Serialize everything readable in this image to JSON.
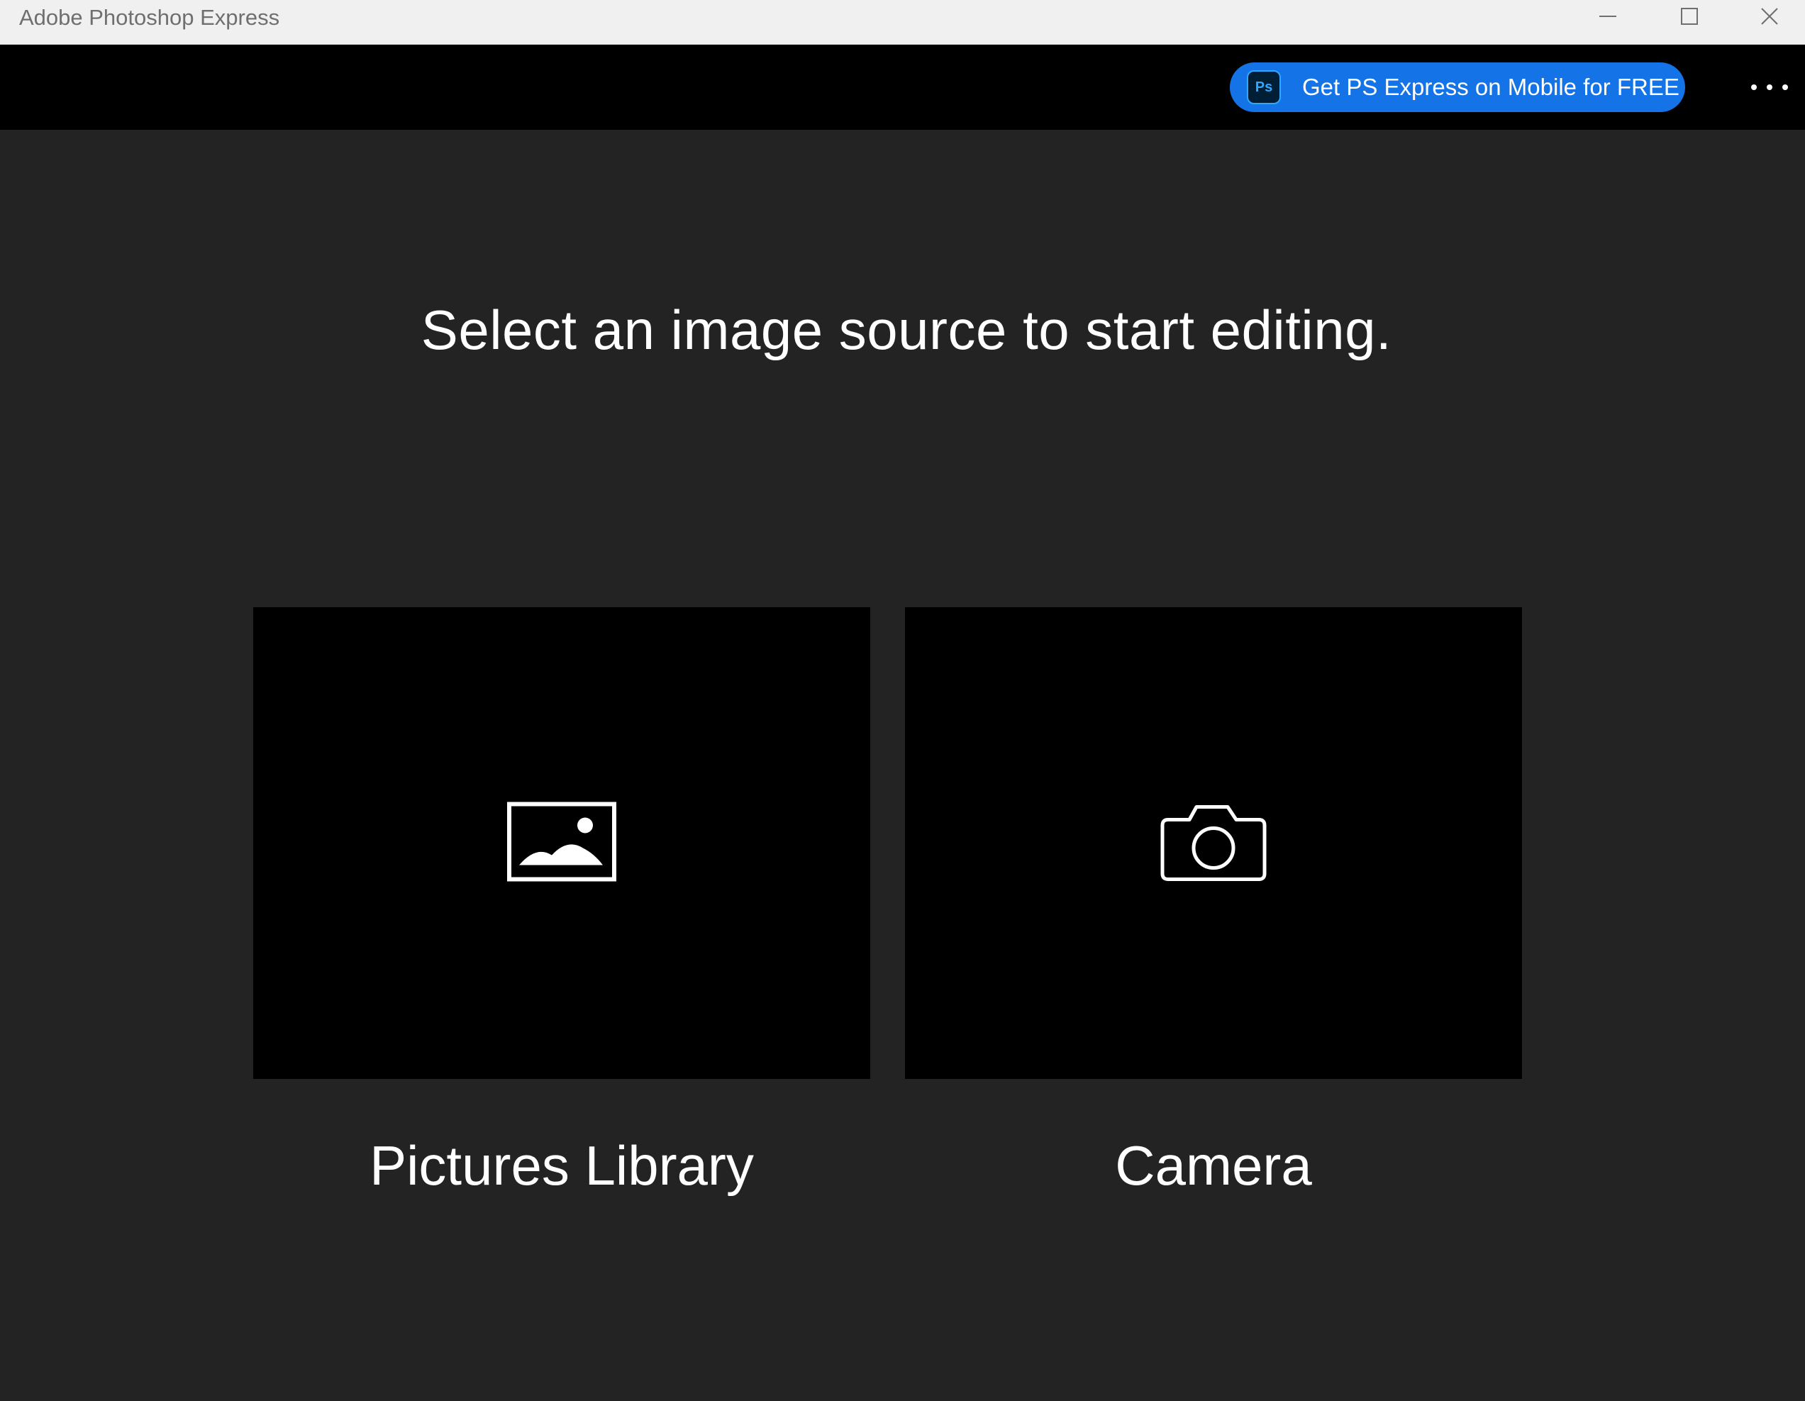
{
  "window": {
    "title": "Adobe Photoshop Express",
    "controls": {
      "minimize_icon": "minimize-icon",
      "maximize_icon": "maximize-icon",
      "close_icon": "close-icon"
    }
  },
  "appbar": {
    "promo": {
      "logo_text": "Ps",
      "label": "Get PS Express on Mobile for FREE",
      "color": "#1473e6"
    },
    "more_icon": "more-horizontal-icon"
  },
  "main": {
    "heading": "Select an image source to start editing.",
    "sources": [
      {
        "label": "Pictures Library",
        "icon": "image-icon"
      },
      {
        "label": "Camera",
        "icon": "camera-icon"
      }
    ]
  },
  "colors": {
    "background": "#232323",
    "appbar": "#000000",
    "tile": "#000000",
    "accent": "#1473e6"
  }
}
